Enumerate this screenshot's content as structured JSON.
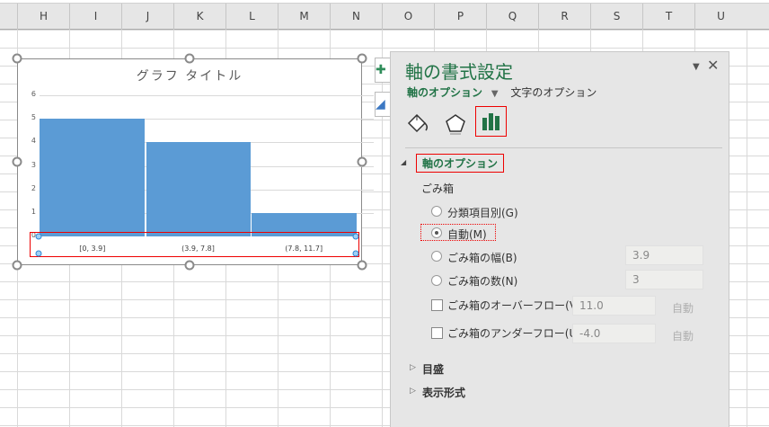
{
  "columns": [
    "H",
    "I",
    "J",
    "K",
    "L",
    "M",
    "N",
    "O",
    "P",
    "Q",
    "R",
    "S",
    "T",
    "U"
  ],
  "chart": {
    "title": "グラフ タイトル",
    "chart_data": {
      "type": "bar",
      "title": "グラフ タイトル",
      "categories": [
        "[0, 3.9]",
        "(3.9, 7.8]",
        "(7.8, 11.7]"
      ],
      "values": [
        5,
        4,
        1
      ],
      "yticks": [
        "0",
        "1",
        "2",
        "3",
        "4",
        "5",
        "6"
      ],
      "ylim": [
        0,
        6
      ],
      "grid": true
    }
  },
  "panel": {
    "title": "軸の書式設定",
    "tab_axis_options": "軸のオプション",
    "tab_text_options": "文字のオプション",
    "section_axis_options": "軸のオプション",
    "bins_label": "ごみ箱",
    "radio_by_category": "分類項目別(G)",
    "radio_auto": "自動(M)",
    "radio_bin_width": "ごみ箱の幅(B)",
    "bin_width_value": "3.9",
    "radio_bin_count": "ごみ箱の数(N)",
    "bin_count_value": "3",
    "overflow_label": "ごみ箱のオーバーフロー(V)",
    "overflow_value": "11.0",
    "overflow_auto": "自動",
    "underflow_label": "ごみ箱のアンダーフロー(U)",
    "underflow_value": "-4.0",
    "underflow_auto": "自動",
    "section_tick_marks": "目盛",
    "section_number_format": "表示形式",
    "selected_radio": "auto"
  },
  "colors": {
    "accent": "#217346",
    "bar": "#5b9bd5",
    "highlight": "#e00000"
  }
}
